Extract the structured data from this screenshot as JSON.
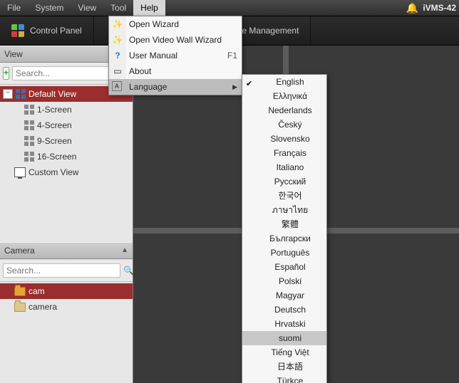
{
  "menubar": {
    "items": [
      "File",
      "System",
      "View",
      "Tool",
      "Help"
    ],
    "active_index": 4
  },
  "brand": "iVMS-42",
  "tabs": {
    "control_panel": "Control Panel",
    "device_mgmt": "ice Management"
  },
  "help_menu": {
    "items": [
      {
        "label": "Open Wizard"
      },
      {
        "label": "Open Video Wall Wizard"
      },
      {
        "label": "User Manual",
        "accel": "F1"
      },
      {
        "label": "About"
      },
      {
        "label": "Language",
        "submenu": true
      }
    ],
    "hover_index": 4
  },
  "languages": {
    "checked_index": 0,
    "hover_index": 18,
    "items": [
      "English",
      "Ελληνικά",
      "Nederlands",
      "Český",
      "Slovensko",
      "Français",
      "Italiano",
      "Русский",
      "한국어",
      "ภาษาไทย",
      "繁體",
      "Български",
      "Português",
      "Español",
      "Polski",
      "Magyar",
      "Deutsch",
      "Hrvatski",
      "suomi",
      "Tiếng Việt",
      "日本語",
      "Türkçe"
    ]
  },
  "view_panel": {
    "title": "View",
    "search_placeholder": "Search...",
    "root": "Default View",
    "screens": [
      "1-Screen",
      "4-Screen",
      "9-Screen",
      "16-Screen"
    ],
    "custom": "Custom View"
  },
  "camera_panel": {
    "title": "Camera",
    "search_placeholder": "Search...",
    "items": [
      "cam",
      "camera"
    ],
    "selected_index": 0
  }
}
